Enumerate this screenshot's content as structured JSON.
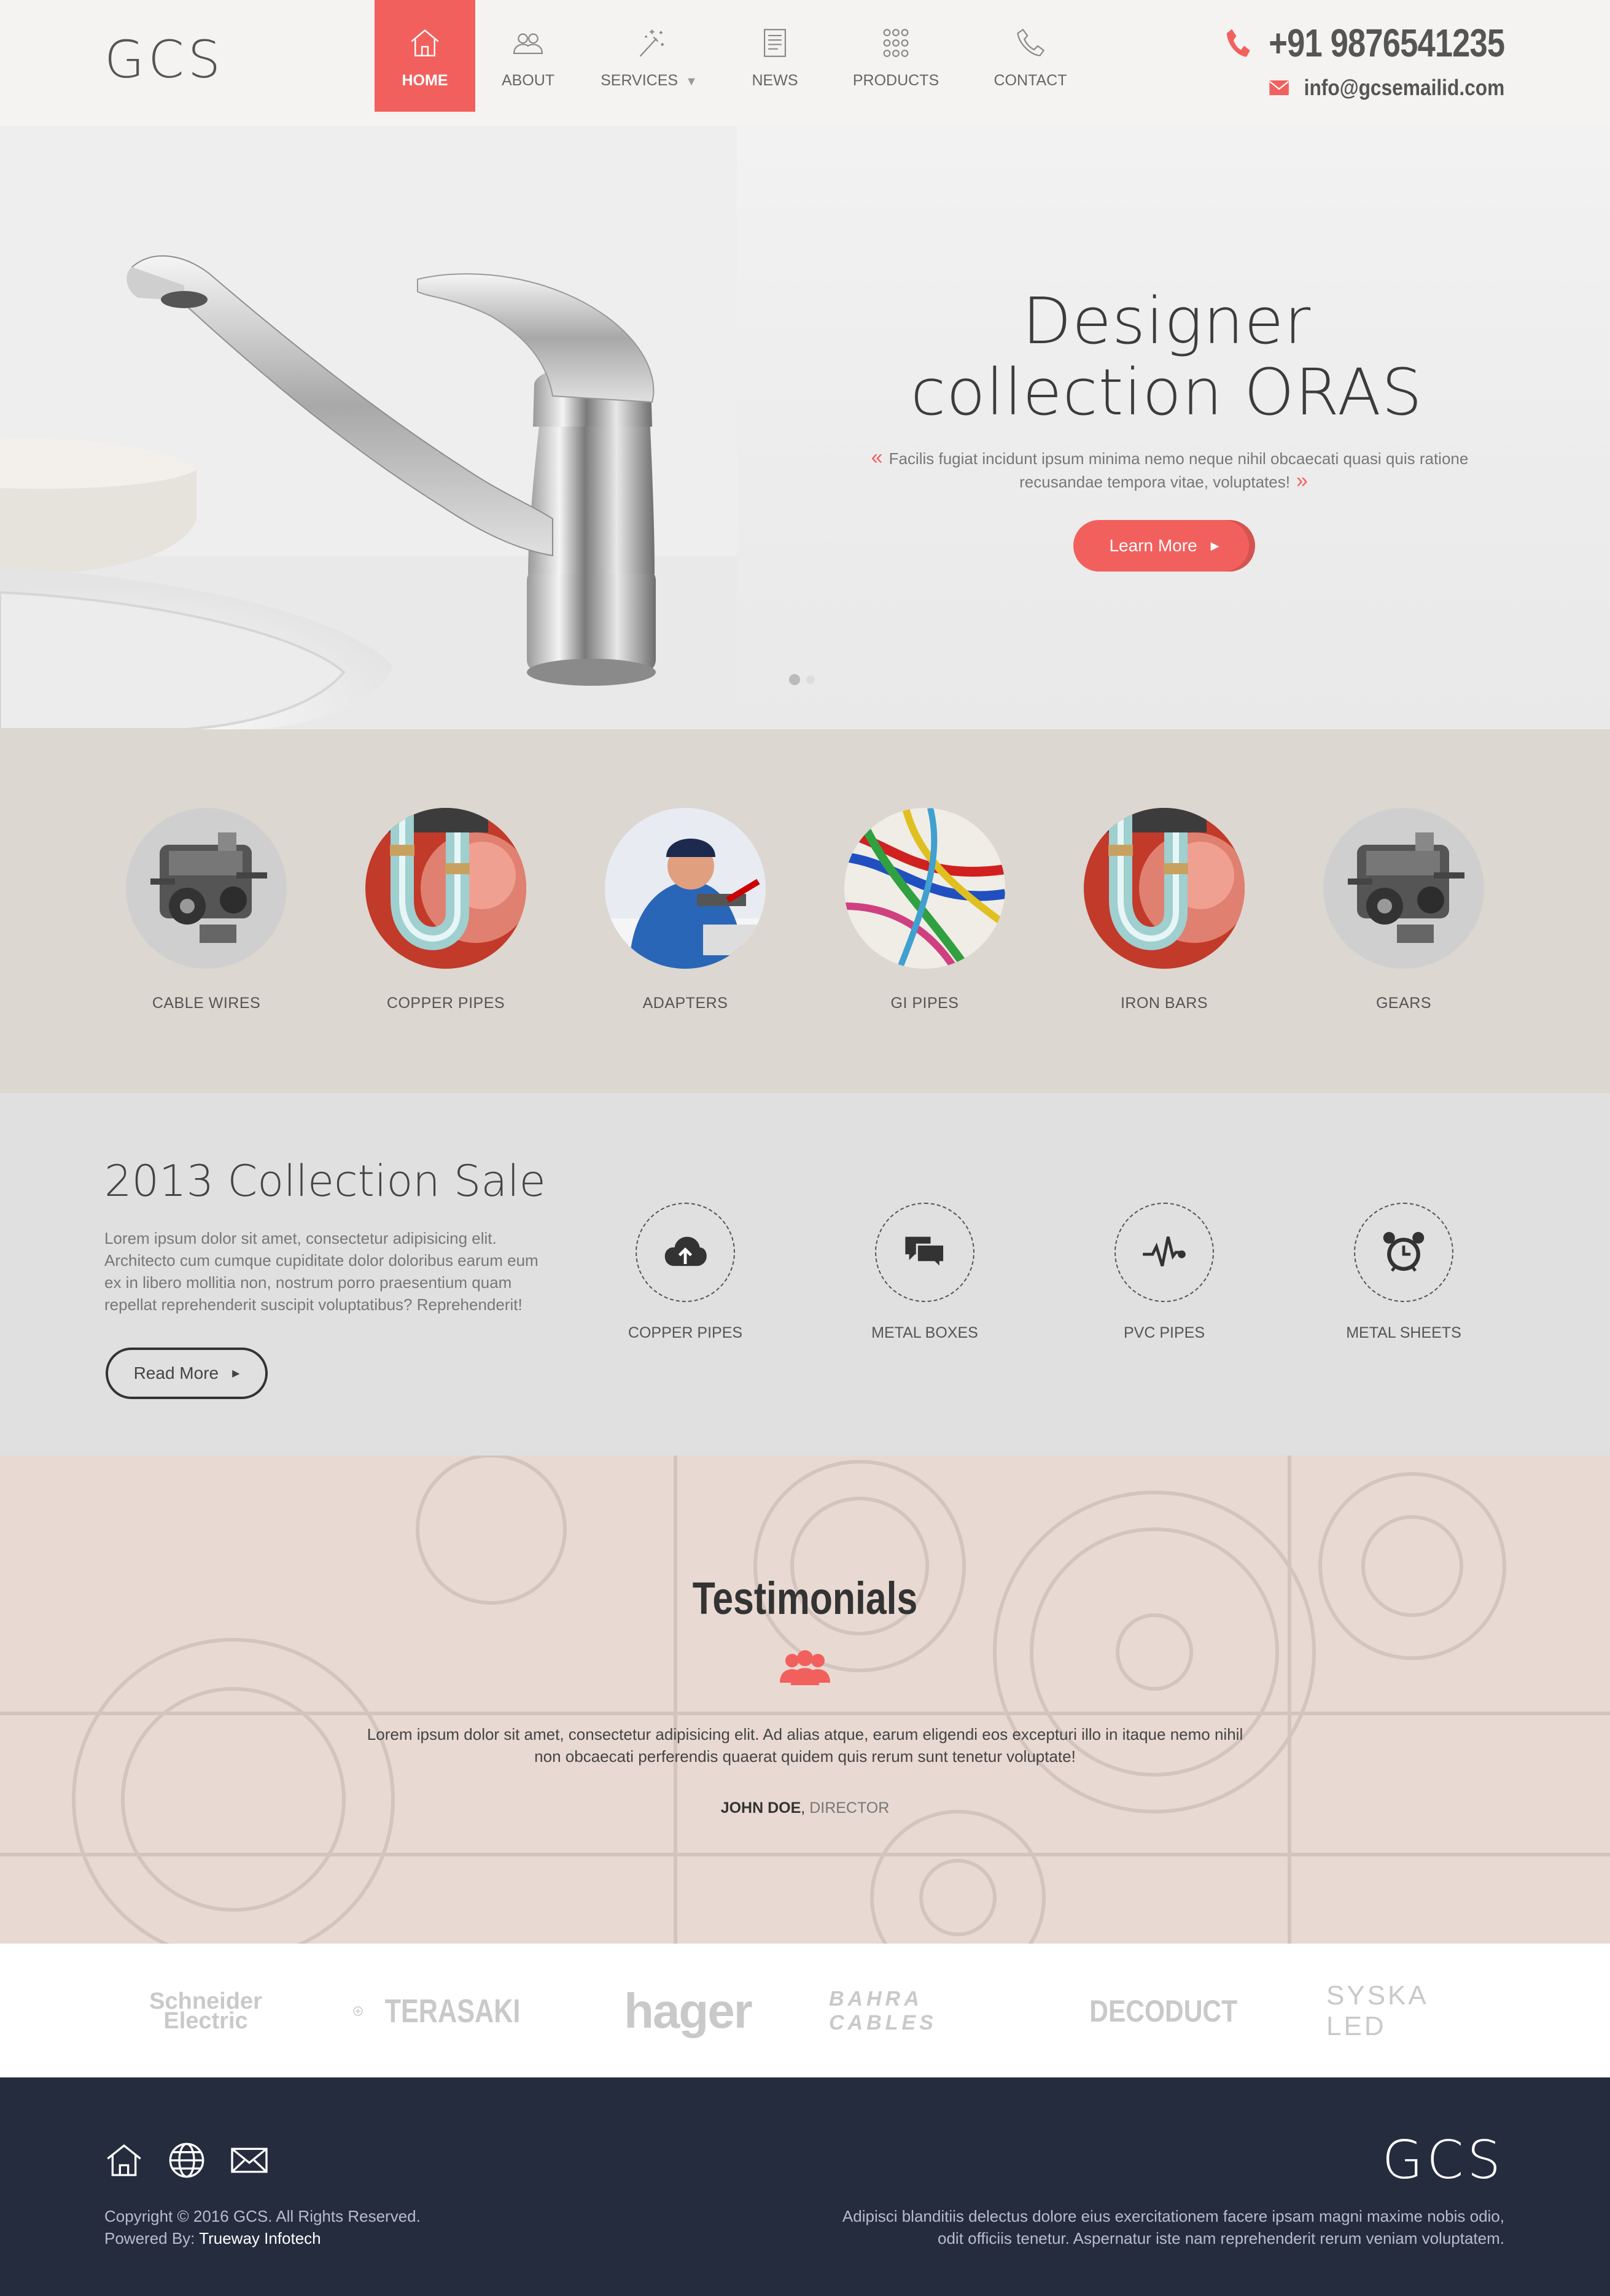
{
  "header": {
    "logo": "GCS",
    "nav": [
      {
        "label": "HOME",
        "icon": "home-icon",
        "active": true
      },
      {
        "label": "ABOUT",
        "icon": "users-icon"
      },
      {
        "label": "SERVICES",
        "icon": "magic-wand-icon",
        "caret": "▼"
      },
      {
        "label": "NEWS",
        "icon": "newspaper-icon"
      },
      {
        "label": "PRODUCTS",
        "icon": "grid-dots-icon"
      },
      {
        "label": "CONTACT",
        "icon": "phone-icon"
      }
    ],
    "phone": "+91 9876541235",
    "email": "info@gcsemailid.com"
  },
  "hero": {
    "title_line1": "Designer",
    "title_line2": "collection ORAS",
    "quote_open": "«",
    "quote": "Facilis fugiat incidunt ipsum minima nemo neque nihil obcaecati quasi quis ratione recusandae tempora vitae, voluptates!",
    "quote_close": "»",
    "button": "Learn More",
    "button_arrow": "▶",
    "slide_count": 2,
    "active_slide": 1
  },
  "categories": [
    {
      "label": "CABLE WIRES",
      "image": "engine"
    },
    {
      "label": "COPPER PIPES",
      "image": "plumber-pipe"
    },
    {
      "label": "ADAPTERS",
      "image": "worker"
    },
    {
      "label": "GI PIPES",
      "image": "wires"
    },
    {
      "label": "IRON BARS",
      "image": "plumber-pipe"
    },
    {
      "label": "GEARS",
      "image": "engine"
    }
  ],
  "sale": {
    "title": "2013 Collection Sale",
    "text": "Lorem ipsum dolor sit amet, consectetur adipisicing elit. Architecto cum cumque cupiditate dolor doloribus earum eum ex in libero mollitia non, nostrum porro praesentium quam repellat reprehenderit suscipit voluptatibus? Reprehenderit!",
    "button": "Read More",
    "button_arrow": "▶",
    "features": [
      {
        "label": "COPPER PIPES",
        "icon": "cloud-upload-icon"
      },
      {
        "label": "METAL BOXES",
        "icon": "chat-bubbles-icon"
      },
      {
        "label": "PVC PIPES",
        "icon": "pulse-icon"
      },
      {
        "label": "METAL SHEETS",
        "icon": "alarm-clock-icon"
      }
    ]
  },
  "testimonials": {
    "title": "Testimonials",
    "icon": "group-icon",
    "text": "Lorem ipsum dolor sit amet, consectetur adipisicing elit. Ad alias atque, earum eligendi eos excepturi illo in itaque nemo nihil non obcaecati perferendis quaerat quidem quis rerum sunt tenetur voluptate!",
    "author": "JOHN DOE",
    "separator": ", ",
    "role": "DIRECTOR"
  },
  "brands": [
    "Schneider Electric",
    "TERASAKI",
    "hager",
    "BAHRA CABLES",
    "DECODUCT",
    "SYSKA LED"
  ],
  "footer": {
    "icons": [
      "home-icon",
      "globe-icon",
      "mail-icon"
    ],
    "logo": "GCS",
    "copyright": "Copyright © 2016 GCS. All Rights Reserved.",
    "powered_label": "Powered By:",
    "powered_by": "Trueway Infotech",
    "text": "Adipisci blanditiis delectus dolore eius exercitationem facere ipsam magni maxime nobis odio, odit officiis tenetur. Aspernatur iste nam reprehenderit rerum veniam voluptatem."
  },
  "colors": {
    "accent": "#f2605d",
    "footer": "#252c3e",
    "cats_bg": "#dcd7d0",
    "sale_bg": "#e0e0e0",
    "testi_bg": "#e8d9d2"
  }
}
